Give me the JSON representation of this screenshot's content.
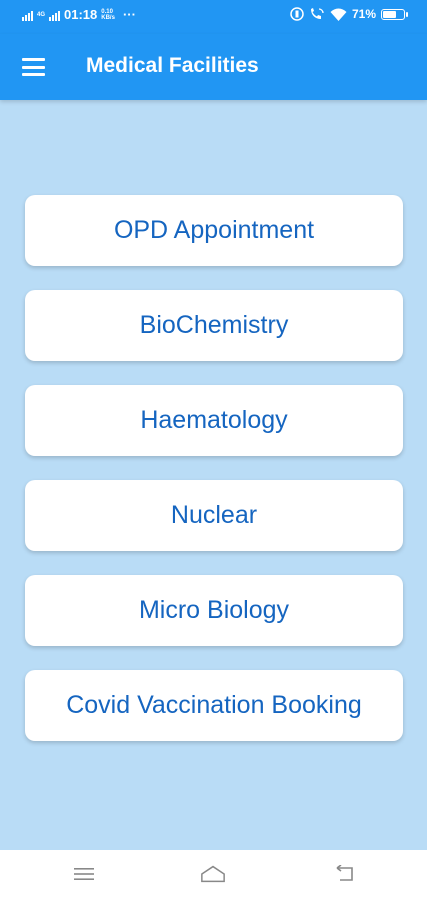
{
  "status_bar": {
    "network": "4G",
    "time": "01:18",
    "speed": "0.10",
    "speed_unit": "KB/s",
    "dots": "···",
    "battery_percent": "71%",
    "battery_level": 0.71
  },
  "app_bar": {
    "title": "Medical Facilities",
    "menu_icon": "hamburger-menu-icon"
  },
  "menu": {
    "items": [
      {
        "label": "OPD Appointment"
      },
      {
        "label": "BioChemistry"
      },
      {
        "label": "Haematology"
      },
      {
        "label": "Nuclear"
      },
      {
        "label": "Micro Biology"
      },
      {
        "label": "Covid Vaccination Booking"
      }
    ]
  },
  "nav_bar": {
    "icons": [
      "recents-icon",
      "home-icon",
      "back-icon"
    ]
  },
  "colors": {
    "primary": "#2196f3",
    "background": "#b9dcf6",
    "button_text": "#1565c0",
    "button_bg": "#ffffff"
  }
}
